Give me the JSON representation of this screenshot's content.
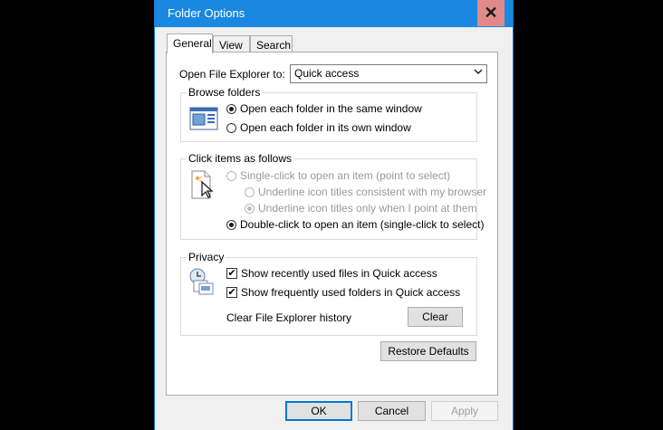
{
  "window": {
    "title": "Folder Options",
    "close_symbol": "✕"
  },
  "tabs": [
    {
      "label": "General"
    },
    {
      "label": "View"
    },
    {
      "label": "Search"
    }
  ],
  "general": {
    "open_explorer_label": "Open File Explorer to:",
    "open_explorer_value": "Quick access",
    "browse": {
      "title": "Browse folders",
      "same_window": "Open each folder in the same window",
      "own_window": "Open each folder in its own window"
    },
    "click": {
      "title": "Click items as follows",
      "single_click": "Single-click to open an item (point to select)",
      "underline_browser": "Underline icon titles consistent with my browser",
      "underline_point": "Underline icon titles only when I point at them",
      "double_click": "Double-click to open an item (single-click to select)"
    },
    "privacy": {
      "title": "Privacy",
      "recent_files": "Show recently used files in Quick access",
      "frequent_folders": "Show frequently used folders in Quick access",
      "clear_label": "Clear File Explorer history",
      "clear_button": "Clear"
    },
    "restore_defaults": "Restore Defaults"
  },
  "footer": {
    "ok": "OK",
    "cancel": "Cancel",
    "apply": "Apply"
  },
  "checkmark": "✔"
}
